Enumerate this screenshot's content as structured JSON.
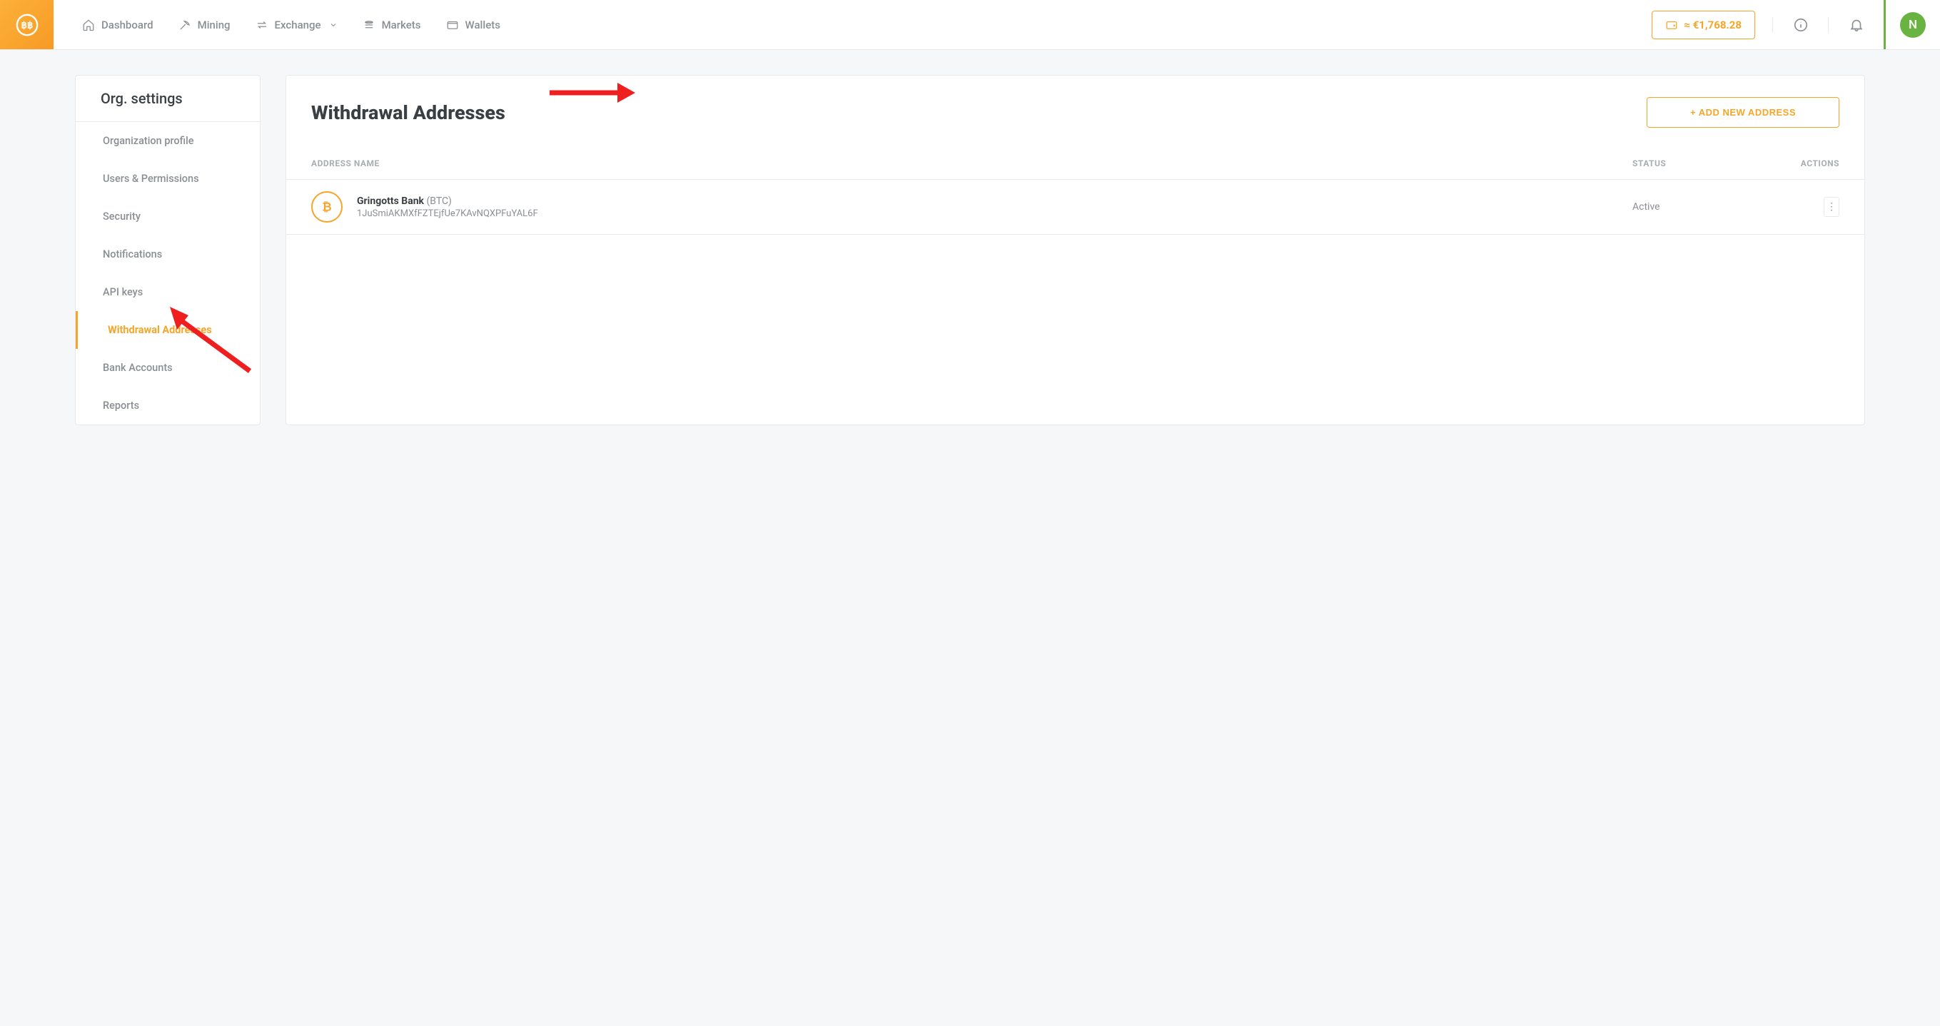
{
  "nav": {
    "items": [
      {
        "label": "Dashboard"
      },
      {
        "label": "Mining"
      },
      {
        "label": "Exchange"
      },
      {
        "label": "Markets"
      },
      {
        "label": "Wallets"
      }
    ],
    "balance_prefix": "≈ ",
    "balance_value": "€1,768.28",
    "avatar_initial": "N"
  },
  "sidebar": {
    "title": "Org. settings",
    "items": [
      {
        "label": "Organization profile"
      },
      {
        "label": "Users & Permissions"
      },
      {
        "label": "Security"
      },
      {
        "label": "Notifications"
      },
      {
        "label": "API keys"
      },
      {
        "label": "Withdrawal Addresses",
        "active": true
      },
      {
        "label": "Bank Accounts"
      },
      {
        "label": "Reports"
      }
    ]
  },
  "main": {
    "title": "Withdrawal Addresses",
    "add_button": "+ ADD NEW ADDRESS",
    "columns": {
      "name": "ADDRESS NAME",
      "status": "STATUS",
      "actions": "ACTIONS"
    },
    "rows": [
      {
        "bank_name": "Gringotts Bank",
        "currency": "(BTC)",
        "address": "1JuSmiAKMXfFZTEjfUe7KAvNQXPFuYAL6F",
        "status": "Active"
      }
    ]
  }
}
